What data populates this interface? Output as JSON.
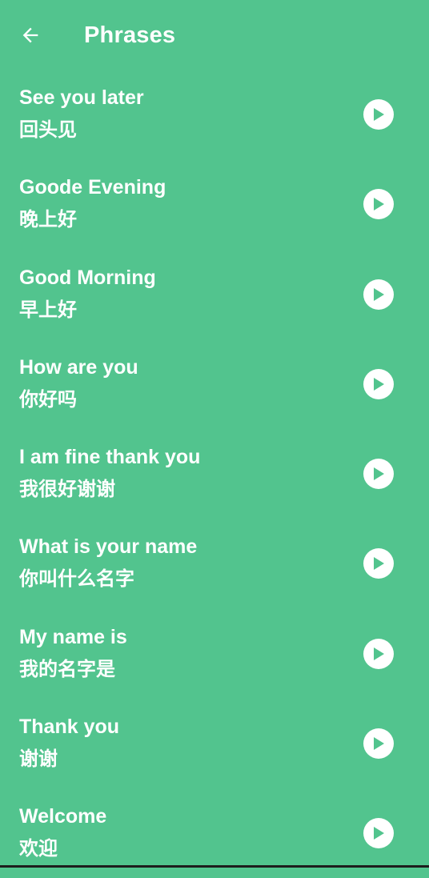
{
  "header": {
    "title": "Phrases",
    "back_icon": "arrow-left-icon"
  },
  "colors": {
    "background": "#52C48E",
    "text": "#FFFFFF",
    "play_icon_fill": "#52C48E"
  },
  "phrases": [
    {
      "english": "See you later",
      "chinese": "回头见"
    },
    {
      "english": "Goode Evening",
      "chinese": "晚上好"
    },
    {
      "english": "Good Morning",
      "chinese": "早上好"
    },
    {
      "english": "How are you",
      "chinese": "你好吗"
    },
    {
      "english": "I am fine thank you",
      "chinese": "我很好谢谢"
    },
    {
      "english": "What is your name",
      "chinese": "你叫什么名字"
    },
    {
      "english": "My name is",
      "chinese": "我的名字是"
    },
    {
      "english": "Thank you",
      "chinese": "谢谢"
    },
    {
      "english": "Welcome",
      "chinese": "欢迎"
    }
  ],
  "item_icon": "play-circle-icon"
}
